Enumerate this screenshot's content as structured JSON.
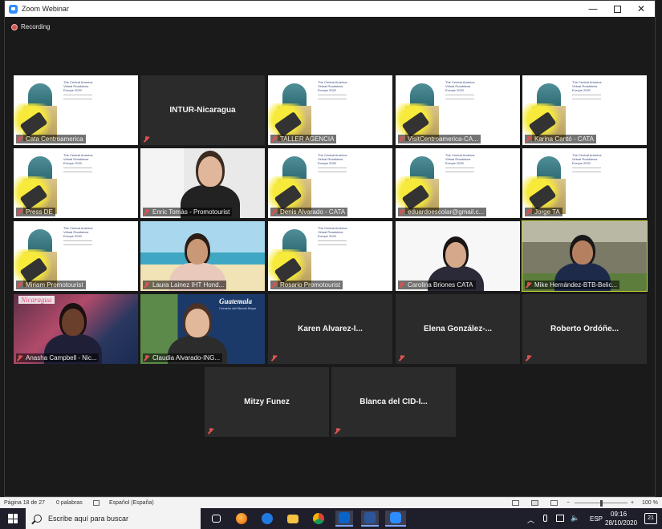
{
  "window": {
    "title": "Zoom Webinar",
    "minimize": "—",
    "close": "✕"
  },
  "recording": {
    "label": "Recording"
  },
  "tiles": [
    {
      "name": "Cata Centroamerica",
      "kind": "poster"
    },
    {
      "name": "INTUR-Nicaragua",
      "kind": "blank"
    },
    {
      "name": "TALLER AGENCIA",
      "kind": "poster"
    },
    {
      "name": "VisitCentroamerica-CA...",
      "kind": "poster"
    },
    {
      "name": "Karina Cantó - CATA",
      "kind": "poster"
    },
    {
      "name": "Press DE",
      "kind": "poster"
    },
    {
      "name": "Enric Tomàs - Promotourist",
      "kind": "video"
    },
    {
      "name": "Denis Alvarado - CATA",
      "kind": "poster"
    },
    {
      "name": "eduardoescolar@gmail.c...",
      "kind": "poster"
    },
    {
      "name": "Jorge TA",
      "kind": "poster"
    },
    {
      "name": "Miriam Promotourist",
      "kind": "poster"
    },
    {
      "name": "Laura Lainez IHT Hond...",
      "kind": "video"
    },
    {
      "name": "Rosario Promotourist",
      "kind": "poster"
    },
    {
      "name": "Carolina Briones CATA",
      "kind": "video"
    },
    {
      "name": "Mike Hernández-BTB-Belic...",
      "kind": "video",
      "active": true
    },
    {
      "name": "Anasha Campbell - Nic...",
      "kind": "video"
    },
    {
      "name": "Claudia Alvarado-ING...",
      "kind": "video"
    },
    {
      "name": "Karen  Alvarez-I...",
      "kind": "blank"
    },
    {
      "name": "Elena  González-...",
      "kind": "blank"
    },
    {
      "name": "Roberto  Ordóñe...",
      "kind": "blank"
    },
    {
      "name": "Mitzy Funez",
      "kind": "blank"
    },
    {
      "name": "Blanca del CID-I...",
      "kind": "blank"
    }
  ],
  "poster_text": {
    "line1": "The Central America",
    "line2": "Virtual Roadshow",
    "line3": "Europe 2020"
  },
  "overlay_text": {
    "nicaragua": "Nicaragua",
    "guatemala": "Guatemala",
    "guatemala_sub": "Corazón del Mundo Maya"
  },
  "word_status": {
    "page": "Página 18 de 27",
    "words": "0 palabras",
    "language": "Español (España)",
    "zoom": "100 %",
    "zoom_minus": "−",
    "zoom_plus": "+"
  },
  "taskbar": {
    "search_placeholder": "Escribe aquí para buscar",
    "lang": "ESP",
    "time": "09:16",
    "date": "28/10/2020",
    "notifications": "21"
  },
  "colors": {
    "accent_active": "#c9d33a",
    "zoom_blue": "#2d8cff",
    "muted_red": "#d9534f"
  }
}
